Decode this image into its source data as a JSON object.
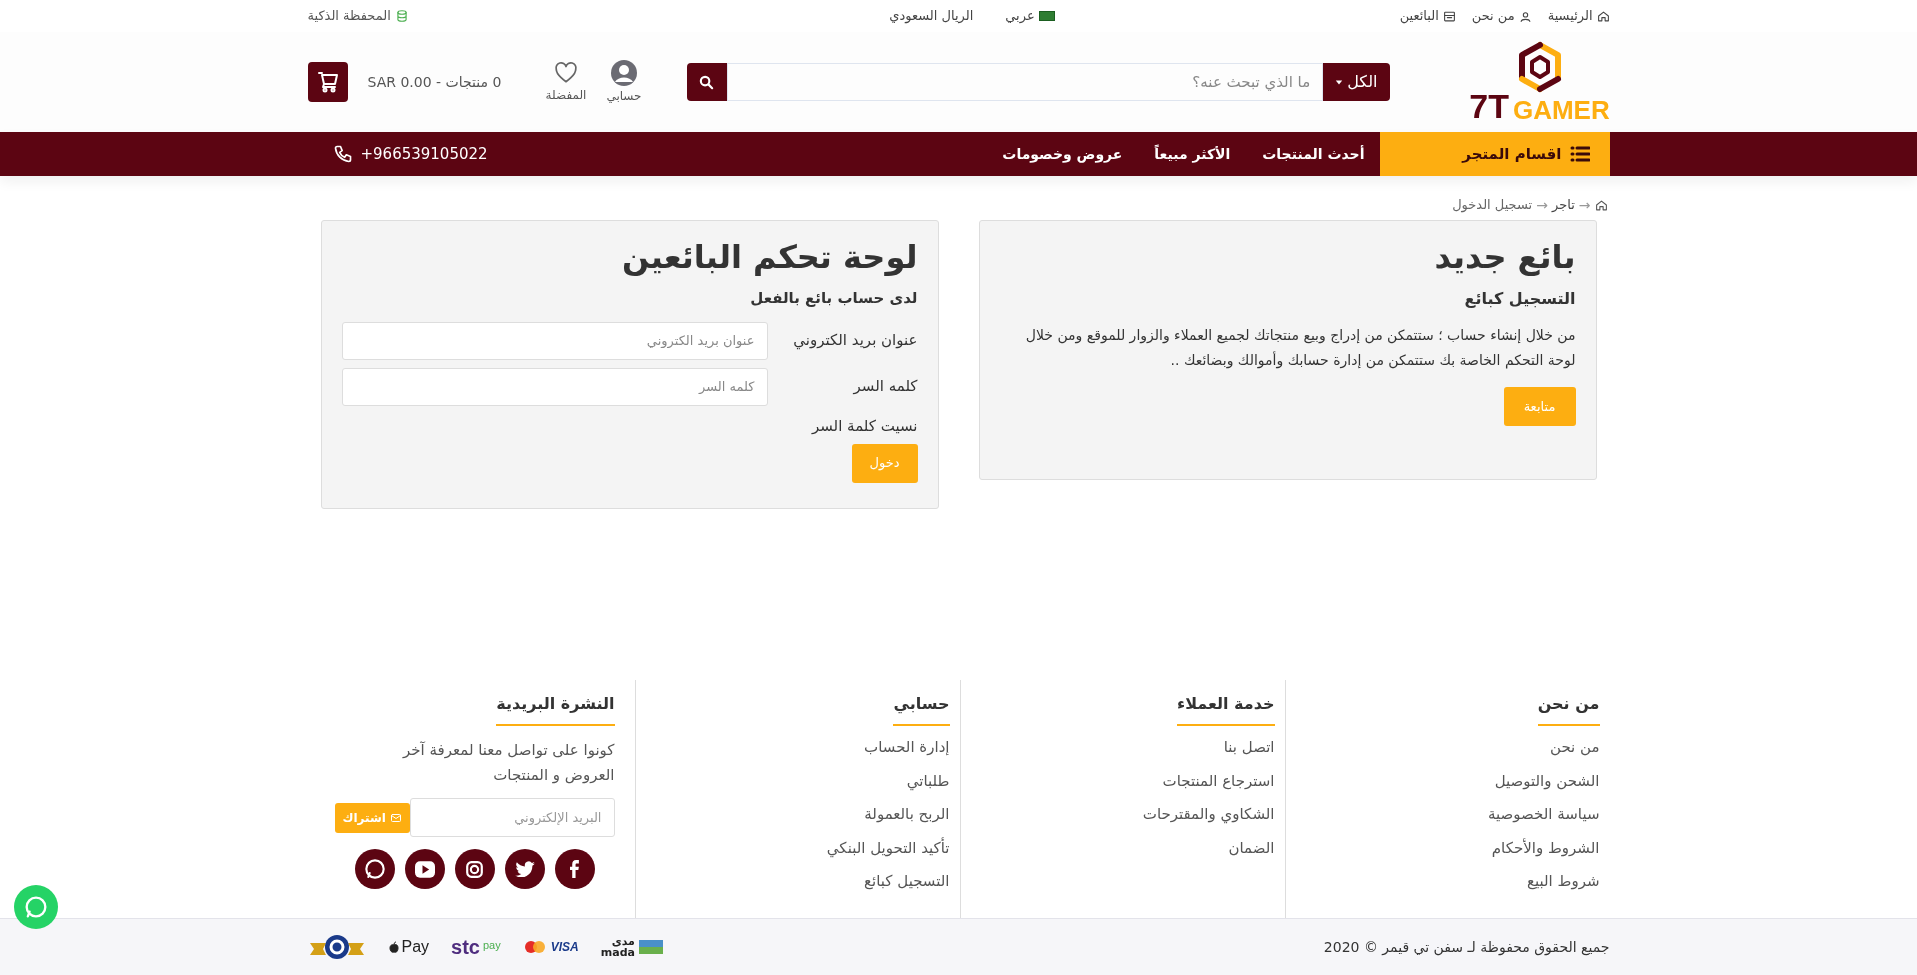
{
  "top_bar": {
    "links": [
      {
        "kind": "home",
        "label": "الرئيسية"
      },
      {
        "kind": "about",
        "label": "من نحن"
      },
      {
        "kind": "sellers",
        "label": "البائعين"
      }
    ],
    "language": "عربي",
    "currency": "الريال السعودي",
    "wallet": "المحفظة الذكية"
  },
  "logo": {
    "number": "7T",
    "word": "GAMER"
  },
  "search": {
    "category": "الكل",
    "placeholder": "ما الذي تبحث عنه؟"
  },
  "account": {
    "label": "حسابي"
  },
  "wishlist": {
    "label": "المفضلة"
  },
  "cart": {
    "summary": "0 منتجات - SAR 0.00"
  },
  "nav": {
    "categories": "اقسام المتجر",
    "links": [
      "أحدث المنتجات",
      "الأكثر مبيعاً",
      "عروض وخصومات"
    ],
    "phone": "+966539105022"
  },
  "breadcrumb": [
    {
      "kind": "separator",
      "text": "→"
    },
    {
      "kind": "link",
      "text": "تاجر"
    },
    {
      "kind": "separator",
      "text": "→"
    },
    {
      "kind": "current",
      "text": "تسجيل الدخول"
    }
  ],
  "new_seller": {
    "title": "بائع جديد",
    "subtitle": "التسجيل كبائع",
    "body": "من خلال إنشاء حساب ؛ ستتمكن من إدراج وبيع منتجاتك لجميع العملاء والزوار للموقع ومن خلال لوحة التحكم الخاصة بك ستتمكن من إدارة حسابك وأموالك وبضائعك ..",
    "button": "متابعة"
  },
  "login": {
    "title": "لوحة تحكم البائعين",
    "subtitle": "لدى حساب بائع بالفعل",
    "fields": [
      {
        "label": "عنوان بريد الكتروني",
        "placeholder": "عنوان بريد الكتروني"
      },
      {
        "label": "كلمه السر",
        "placeholder": "كلمه السر"
      }
    ],
    "forgot": "نسيت كلمة السر",
    "button": "دخول"
  },
  "footer": {
    "columns": [
      {
        "title": "من نحن",
        "links": [
          "من نحن",
          "الشحن والتوصيل",
          "سياسة الخصوصية",
          "الشروط والأحكام",
          "شروط البيع"
        ]
      },
      {
        "title": "خدمة العملاء",
        "links": [
          "اتصل بنا",
          "استرجاع المنتجات",
          "الشكاوي والمقترحات",
          "الضمان"
        ]
      },
      {
        "title": "حسابي",
        "links": [
          "إدارة الحساب",
          "طلباتي",
          "الربح بالعمولة",
          "تأكيد التحويل البنكي",
          "التسجيل كبائع"
        ]
      }
    ],
    "newsletter": {
      "title": "النشرة البريدية",
      "text": "كونوا على تواصل معنا لمعرفة آخر العروض و المنتجات",
      "placeholder": "البريد الإلكتروني",
      "button": "اشتراك"
    },
    "copyright": "جميع الحقوق محفوظة لـ سفن تي قيمر © 2020",
    "payments": [
      {
        "kind": "mada",
        "texts": [
          "مدى",
          "mada"
        ]
      },
      {
        "kind": "visa",
        "texts": [
          "VISA"
        ]
      },
      {
        "kind": "stc",
        "texts": [
          "stc",
          "pay"
        ]
      },
      {
        "kind": "applepay",
        "texts": [
          "Pay"
        ]
      },
      {
        "kind": "badge"
      }
    ]
  }
}
